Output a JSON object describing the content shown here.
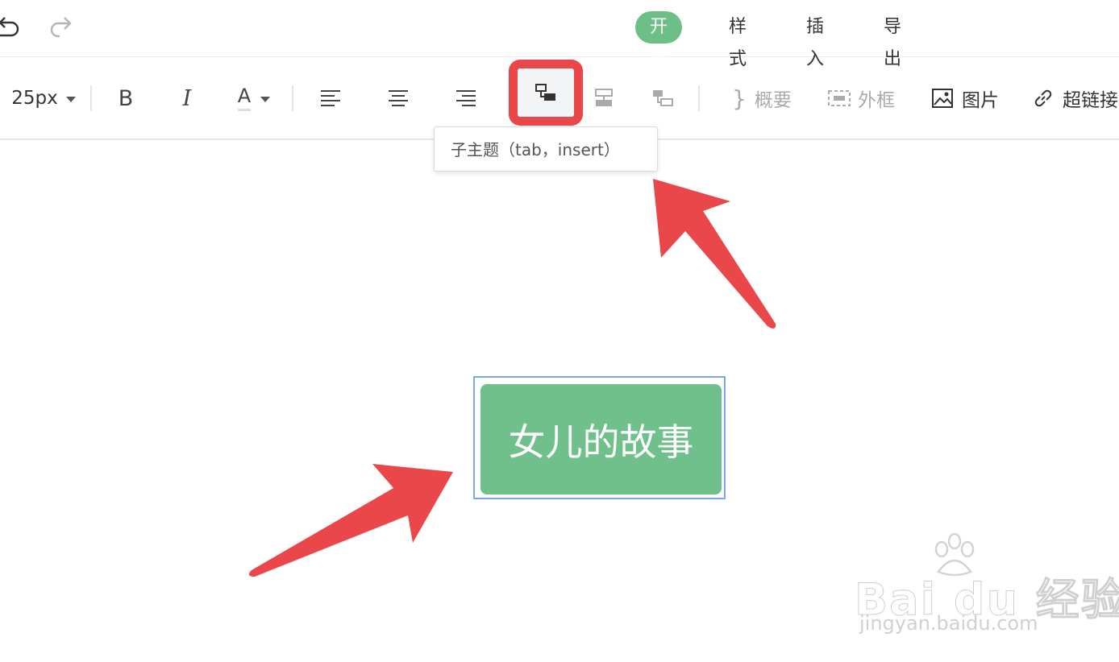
{
  "topbar": {
    "undo_icon": "undo-icon",
    "redo_icon": "redo-icon",
    "tabs": [
      {
        "label": "开始",
        "active": true
      },
      {
        "label": "样式",
        "active": false
      },
      {
        "label": "插入",
        "active": false
      },
      {
        "label": "导出",
        "active": false
      }
    ],
    "accent_color": "#6bbf87"
  },
  "toolbar": {
    "font_size": "25px",
    "bold_label": "B",
    "italic_label": "I",
    "font_color_label": "A",
    "summary_label": "概要",
    "frame_label": "外框",
    "image_label": "图片",
    "link_label": "超链接"
  },
  "tooltip": {
    "text": "子主题（tab，insert）"
  },
  "canvas": {
    "node_text": "女儿的故事",
    "node_color": "#6fc08b"
  },
  "watermark": {
    "brand": "Bai du 经验",
    "url": "jingyan.baidu.com"
  },
  "annotation_color": "#e9474a"
}
